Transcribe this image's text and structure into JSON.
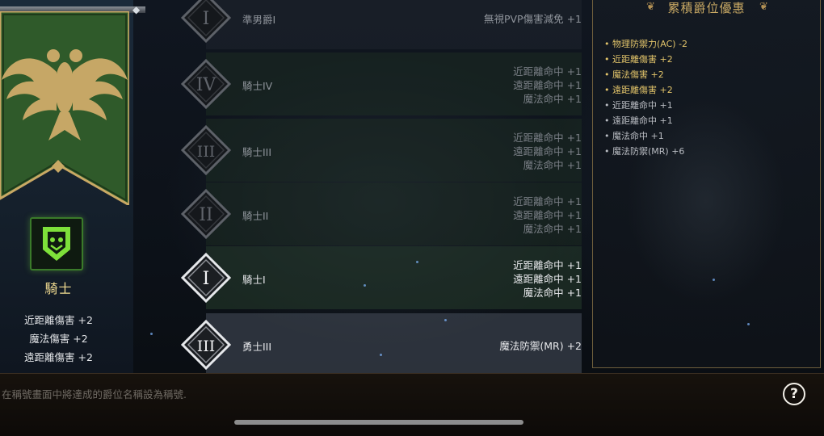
{
  "left_panel": {
    "rank_name": "騎士",
    "bonuses": [
      "近距離傷害 +2",
      "魔法傷害 +2",
      "遠距離傷害 +2"
    ],
    "banner_color": "#2f5a2a",
    "badge_color": "#7ee03a",
    "banner_icon": "double-headed-eagle-icon",
    "badge_icon": "shield-face-icon"
  },
  "rank_list": [
    {
      "numeral": "I",
      "name": "準男爵I",
      "stats": [
        "無視PVP傷害減免 +1"
      ],
      "state": "plain"
    },
    {
      "numeral": "IV",
      "name": "騎士IV",
      "stats": [
        "近距離命中 +1",
        "遠距離命中 +1",
        "魔法命中 +1"
      ],
      "state": "locked"
    },
    {
      "numeral": "III",
      "name": "騎士III",
      "stats": [
        "近距離命中 +1",
        "遠距離命中 +1",
        "魔法命中 +1"
      ],
      "state": "locked"
    },
    {
      "numeral": "II",
      "name": "騎士II",
      "stats": [
        "近距離命中 +1",
        "遠距離命中 +1",
        "魔法命中 +1"
      ],
      "state": "locked"
    },
    {
      "numeral": "I",
      "name": "騎士I",
      "stats": [
        "近距離命中 +1",
        "遠距離命中 +1",
        "魔法命中 +1"
      ],
      "state": "current"
    },
    {
      "numeral": "III",
      "name": "勇士III",
      "stats": [
        "魔法防禦(MR) +2"
      ],
      "state": "selected"
    }
  ],
  "summary": {
    "title": "累積爵位優惠",
    "items": [
      {
        "text": "物理防禦力(AC) -2",
        "color": "#e2c46a"
      },
      {
        "text": "近距離傷害 +2",
        "color": "#e2c46a"
      },
      {
        "text": "魔法傷害 +2",
        "color": "#e2c46a"
      },
      {
        "text": "遠距離傷害 +2",
        "color": "#e2c46a"
      },
      {
        "text": "近距離命中 +1",
        "color": "#b9bcc2"
      },
      {
        "text": "遠距離命中 +1",
        "color": "#b9bcc2"
      },
      {
        "text": "魔法命中 +1",
        "color": "#b9bcc2"
      },
      {
        "text": "魔法防禦(MR) +6",
        "color": "#b9bcc2"
      }
    ]
  },
  "bottom": {
    "hint": "在稱號畫面中將達成的爵位名稱設為稱號.",
    "help_symbol": "?"
  }
}
